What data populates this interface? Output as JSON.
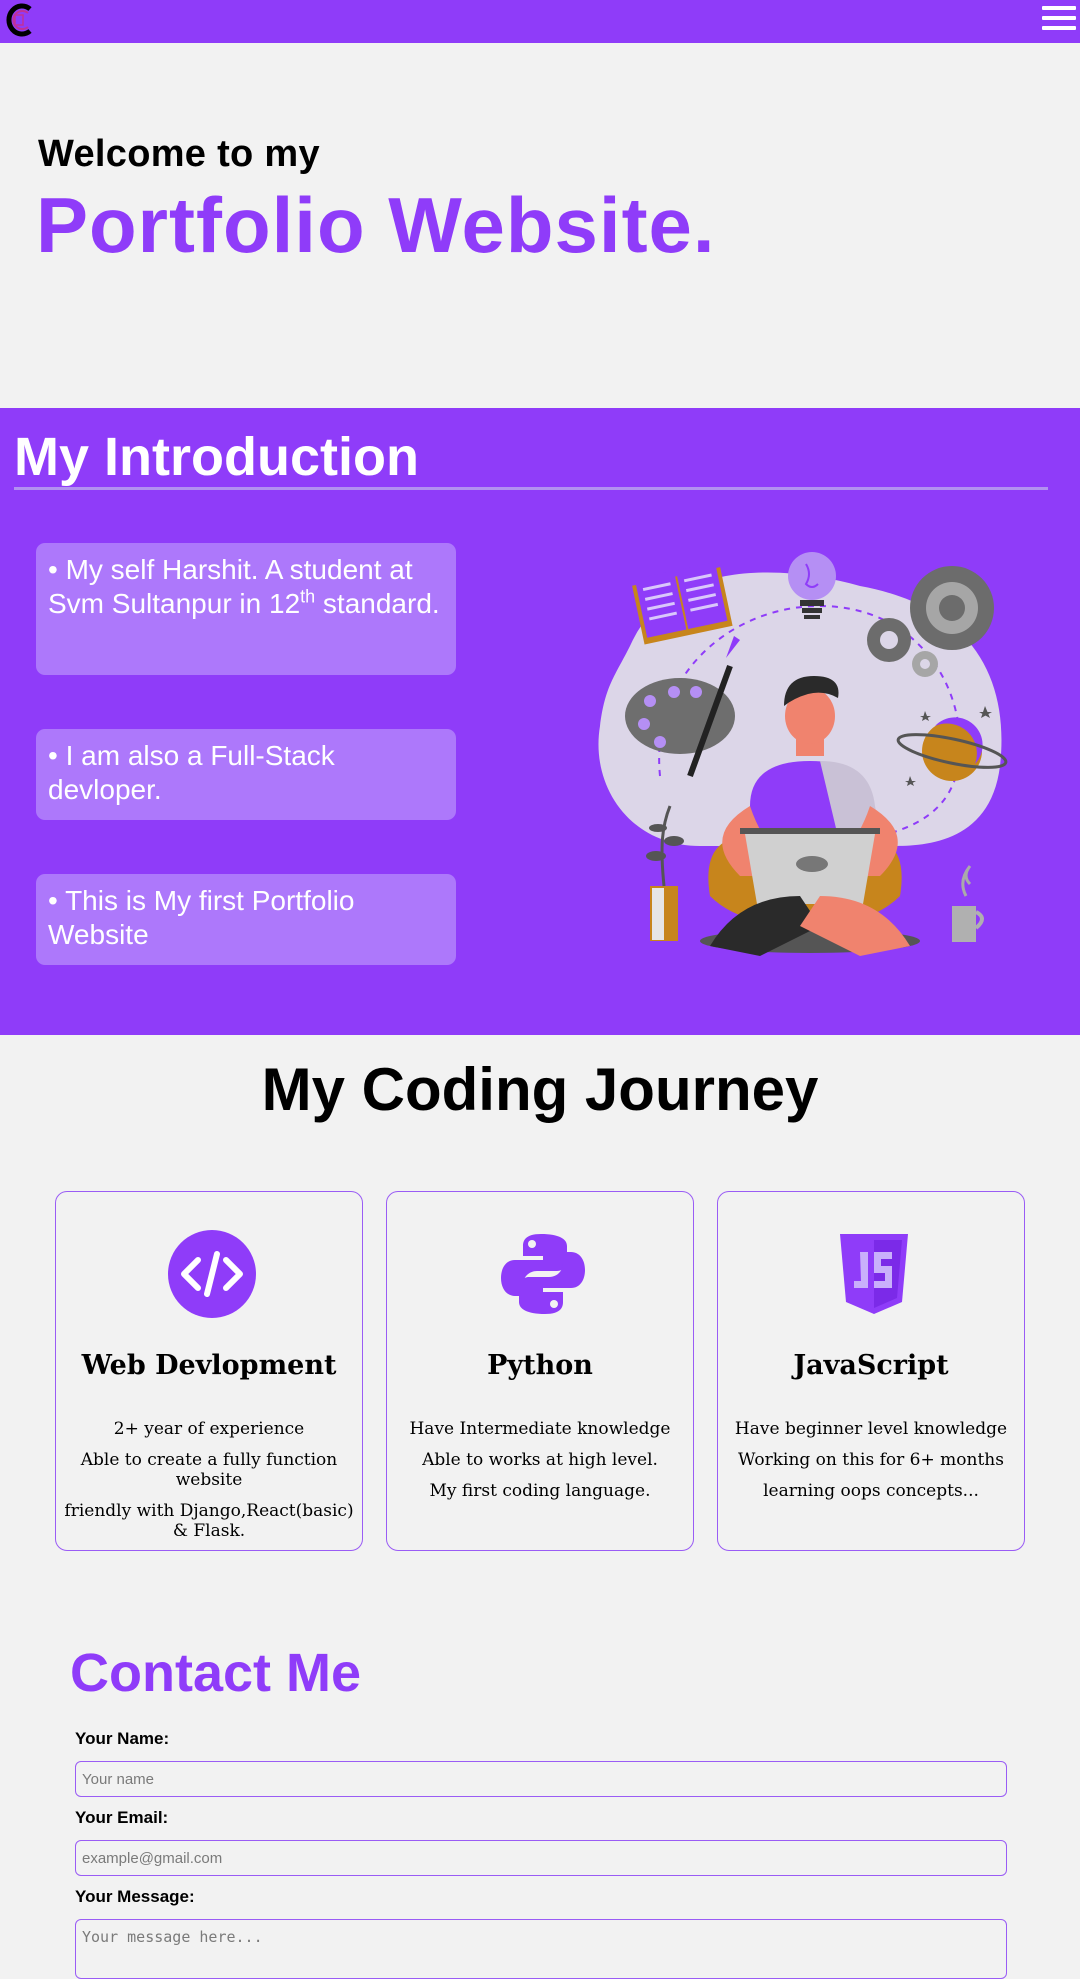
{
  "navbar": {
    "logo_icon": "c-logo-icon",
    "menu_icon": "hamburger-menu-icon"
  },
  "hero": {
    "subtitle": "Welcome to my",
    "title": "Portfolio Website."
  },
  "intro": {
    "title": "My Introduction",
    "cards": [
      {
        "text_before": "• My self Harshit. A student at Svm Sultanpur in 12",
        "superscript": "th",
        "text_after": " standard."
      },
      {
        "text": "• I am also a Full-Stack devloper."
      },
      {
        "text": "• This is My first Portfolio Website"
      }
    ],
    "illustration": "person-meditating-with-laptop-illustration"
  },
  "journey": {
    "title": "My Coding Journey",
    "cards": [
      {
        "icon": "code-icon",
        "title": "Web Devlopment",
        "lines": [
          "2+ year of experience",
          "Able to create a fully function website",
          "friendly with Django,React(basic) & Flask."
        ]
      },
      {
        "icon": "python-icon",
        "title": "Python",
        "lines": [
          "Have Intermediate knowledge",
          "Able to works at high level.",
          "My first coding language."
        ]
      },
      {
        "icon": "javascript-icon",
        "title": "JavaScript",
        "lines": [
          "Have beginner level knowledge",
          "Working on this for 6+ months",
          "learning oops concepts..."
        ]
      }
    ]
  },
  "contact": {
    "title": "Contact Me",
    "name_label": "Your Name:",
    "name_placeholder": "Your name",
    "email_label": "Your Email:",
    "email_placeholder": "example@gmail.com",
    "message_label": "Your Message:",
    "message_placeholder": "Your message here..."
  },
  "colors": {
    "accent": "#8f3cf9",
    "card": "#ad78fb",
    "background": "#f2f2f2"
  }
}
